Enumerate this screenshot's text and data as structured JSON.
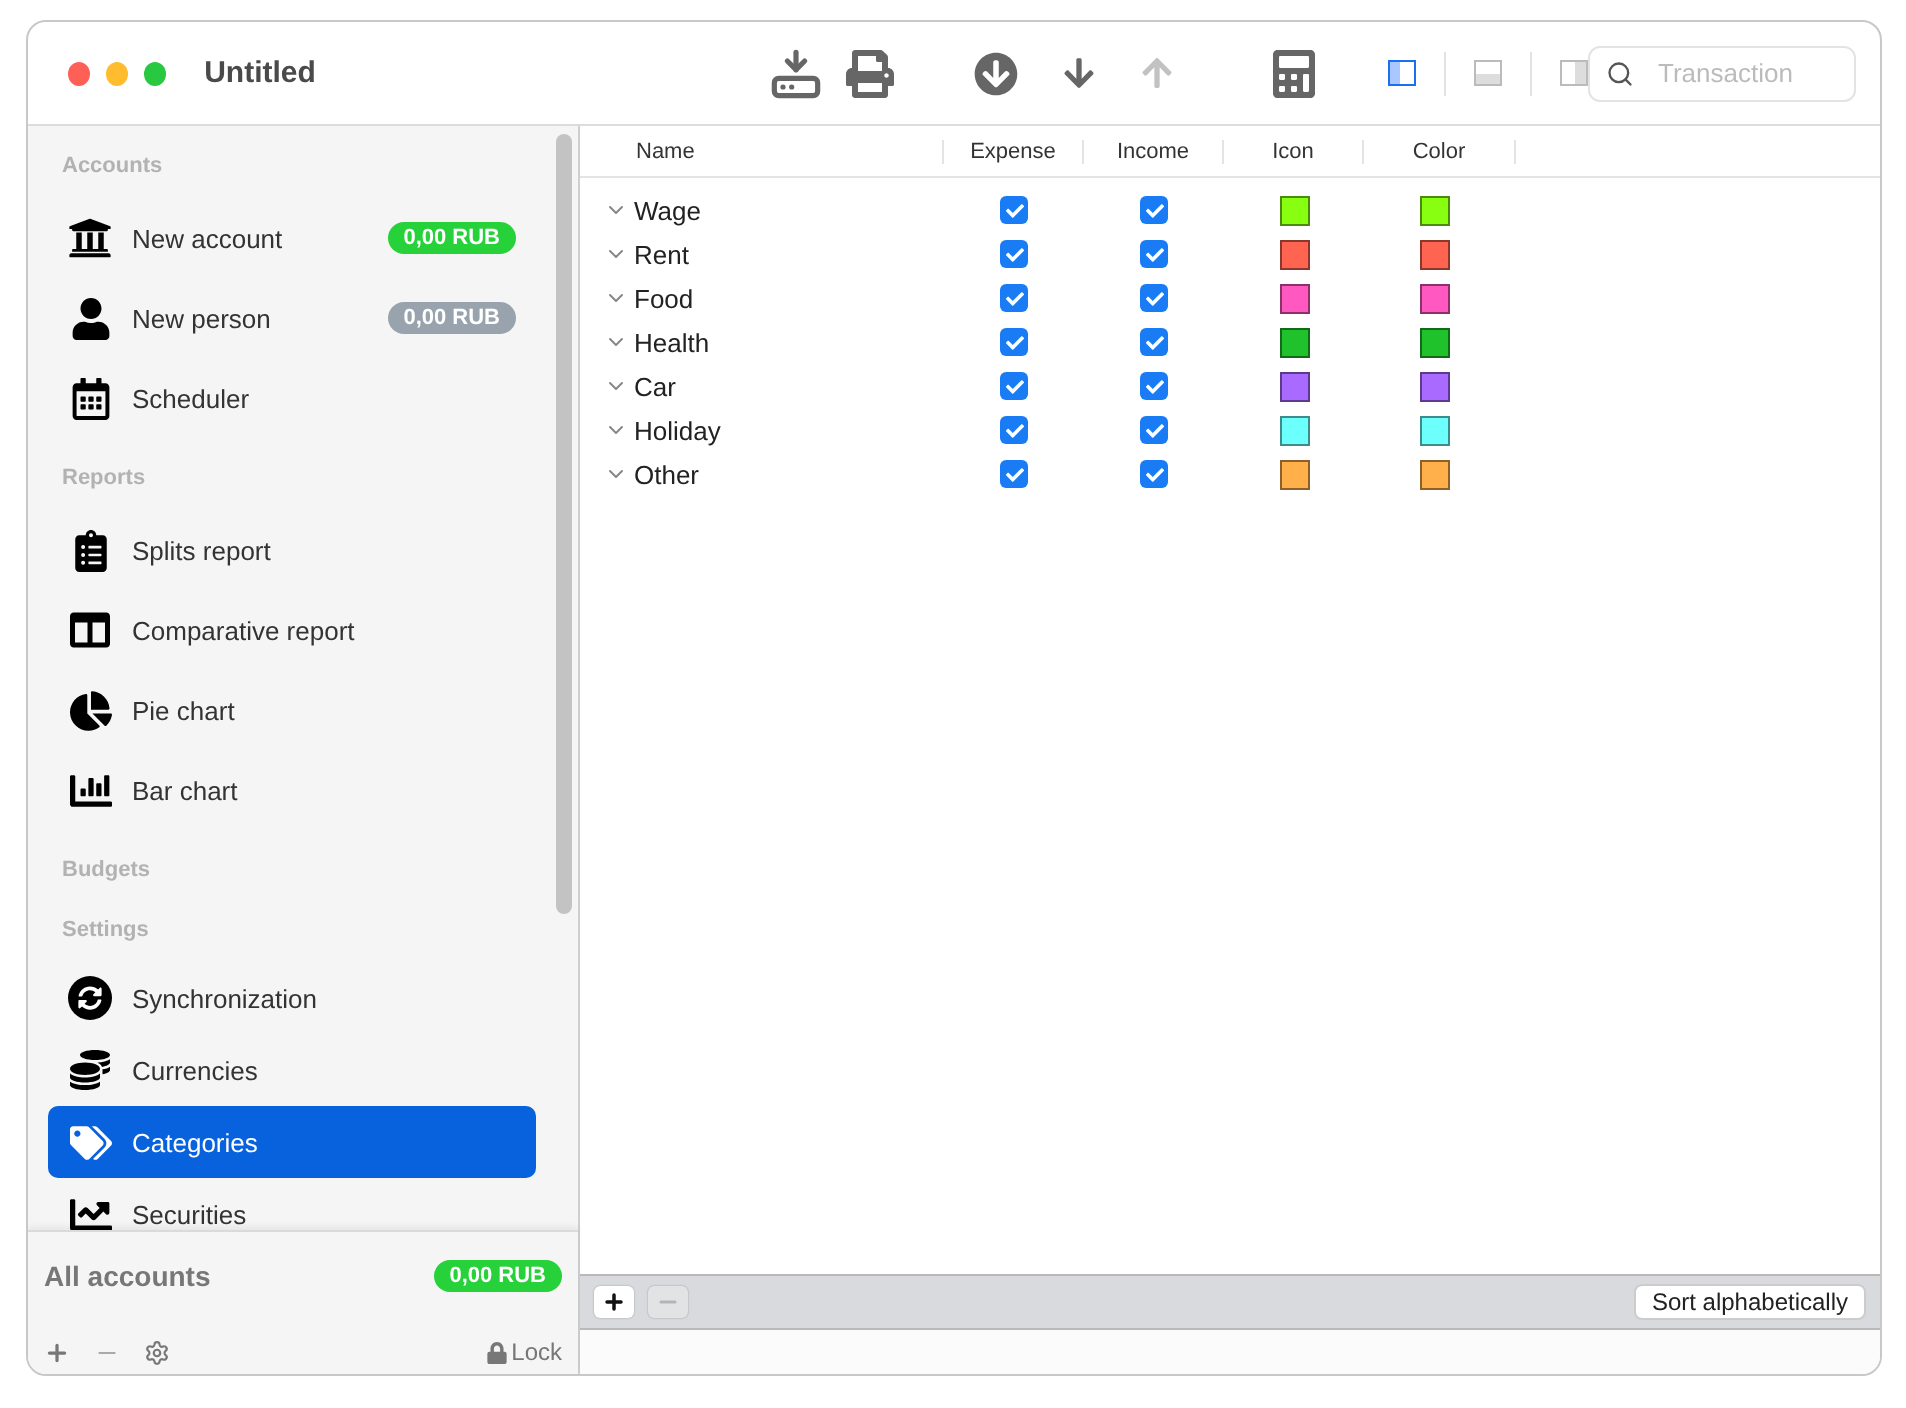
{
  "window": {
    "title": "Untitled"
  },
  "toolbar": {
    "buttons": [
      {
        "kind": "import",
        "disabled": false
      },
      {
        "kind": "print",
        "disabled": false
      },
      {
        "kind": "circle-down",
        "disabled": false
      },
      {
        "kind": "down",
        "disabled": false
      },
      {
        "kind": "up",
        "disabled": true
      },
      {
        "kind": "calculator",
        "disabled": false
      }
    ],
    "layouts": [
      {
        "kind": "left",
        "selected": true
      },
      {
        "kind": "bottom",
        "selected": false
      },
      {
        "kind": "right",
        "selected": false
      }
    ],
    "search": {
      "placeholder": "Transaction"
    }
  },
  "sidebar": {
    "sections": [
      {
        "title": "Accounts",
        "items": [
          {
            "label": "New account",
            "kind": "bank",
            "badge": "0,00 RUB",
            "color": "#27d13a",
            "selected": false
          },
          {
            "label": "New person",
            "kind": "person",
            "badge": "0,00 RUB",
            "color": "#99a3ad",
            "selected": false
          },
          {
            "label": "Scheduler",
            "kind": "calendar",
            "selected": false
          }
        ]
      },
      {
        "title": "Reports",
        "items": [
          {
            "label": "Splits report",
            "kind": "clipboard",
            "selected": false
          },
          {
            "label": "Comparative report",
            "kind": "compare",
            "selected": false
          },
          {
            "label": "Pie chart",
            "kind": "pie",
            "selected": false
          },
          {
            "label": "Bar chart",
            "kind": "bar",
            "selected": false
          }
        ]
      },
      {
        "title": "Budgets"
      },
      {
        "title": "Settings",
        "items": [
          {
            "label": "Synchronization",
            "kind": "sync",
            "selected": false
          },
          {
            "label": "Currencies",
            "kind": "coins",
            "selected": false
          },
          {
            "label": "Categories",
            "kind": "tags",
            "selected": true
          },
          {
            "label": "Securities",
            "kind": "stocks",
            "selected": false
          }
        ]
      }
    ],
    "total": {
      "label": "All accounts",
      "badge": "0,00 RUB",
      "color": "#27d13a"
    },
    "lock": "Lock"
  },
  "table": {
    "columns": [
      "Name",
      "Expense",
      "Income",
      "Icon",
      "Color"
    ],
    "rows": [
      {
        "name": "Wage",
        "expanded": true,
        "expense": true,
        "income": true,
        "color": "#88ff11"
      },
      {
        "name": "Rent",
        "expanded": true,
        "expense": true,
        "income": true,
        "color": "#ff6450"
      },
      {
        "name": "Food",
        "expanded": true,
        "expense": true,
        "income": true,
        "color": "#ff58c0"
      },
      {
        "name": "Health",
        "expanded": true,
        "expense": true,
        "income": true,
        "color": "#1fc22a"
      },
      {
        "name": "Car",
        "expanded": true,
        "expense": true,
        "income": true,
        "color": "#a96bff"
      },
      {
        "name": "Holiday",
        "expanded": true,
        "expense": true,
        "income": true,
        "color": "#6cfffc"
      },
      {
        "name": "Other",
        "expanded": true,
        "expense": true,
        "income": true,
        "color": "#ffb04a"
      }
    ]
  },
  "bottom_bar": {
    "remove_disabled": true,
    "sort_button": "Sort alphabetically"
  }
}
